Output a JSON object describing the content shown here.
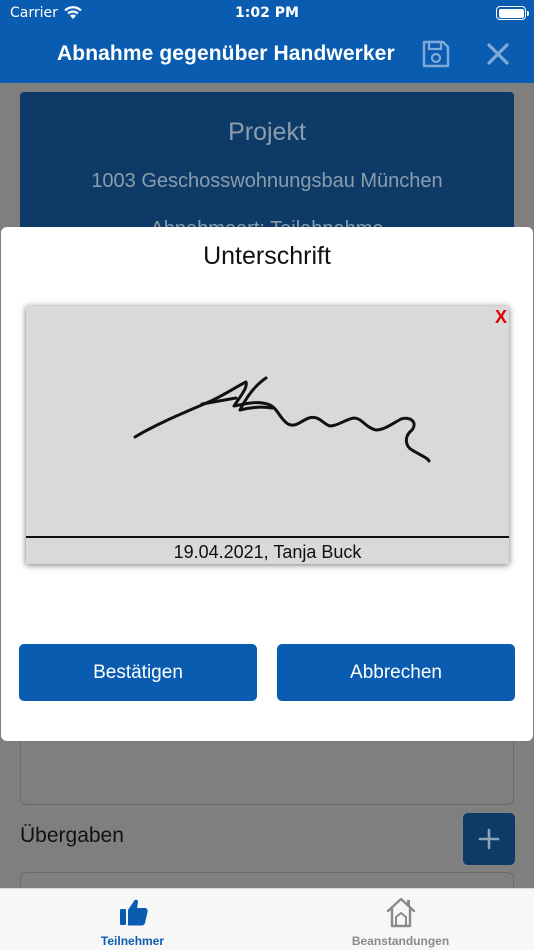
{
  "status_bar": {
    "carrier": "Carrier",
    "time": "1:02 PM"
  },
  "nav": {
    "title": "Abnahme gegenüber Handwerker",
    "save_icon": "save-icon",
    "close_icon": "close-icon"
  },
  "project_card": {
    "heading": "Projekt",
    "project": "1003 Geschosswohnungsbau München",
    "acceptance_type": "Abnahmeart: Teilabnahme"
  },
  "section": {
    "label": "Übergaben",
    "add_icon": "plus-icon"
  },
  "signature_dialog": {
    "title": "Unterschrift",
    "clear_label": "X",
    "caption": "19.04.2021, Tanja Buck",
    "confirm_label": "Bestätigen",
    "cancel_label": "Abbrechen"
  },
  "tabbar": {
    "items": [
      {
        "label": "Teilnehmer",
        "icon": "thumbs-up-icon",
        "active": true
      },
      {
        "label": "Beanstandungen",
        "icon": "house-icon",
        "active": false
      }
    ]
  },
  "colors": {
    "brand": "#0a5cb0",
    "card": "#0d3a66",
    "danger": "#e00000"
  }
}
